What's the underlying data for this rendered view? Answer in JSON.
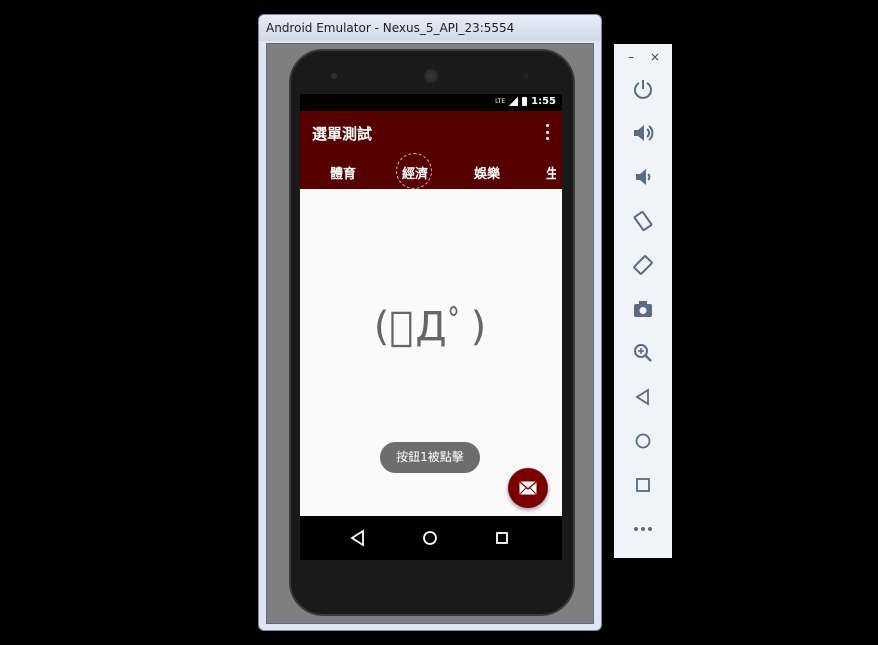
{
  "emulator": {
    "title": "Android Emulator - Nexus_5_API_23:5554"
  },
  "statusbar": {
    "lte": "LTE",
    "time": "1:55"
  },
  "app": {
    "title": "選單測試",
    "tabs": [
      "體育",
      "經濟",
      "娛樂",
      "生"
    ],
    "active_tab": "經濟"
  },
  "content": {
    "kaomoji": "(ﾟДﾟ)",
    "toast": "按鈕1被點擊"
  },
  "toolbar": {
    "minimize": "–",
    "close": "×",
    "buttons": [
      "power-icon",
      "volume-up-icon",
      "volume-down-icon",
      "rotate-left-icon",
      "rotate-right-icon",
      "camera-icon",
      "zoom-icon",
      "back-icon",
      "home-icon",
      "overview-icon",
      "more-icon"
    ]
  },
  "colors": {
    "appbar": "#560000",
    "fab": "#7a0000",
    "toolbar_icon": "#5a6b86"
  }
}
